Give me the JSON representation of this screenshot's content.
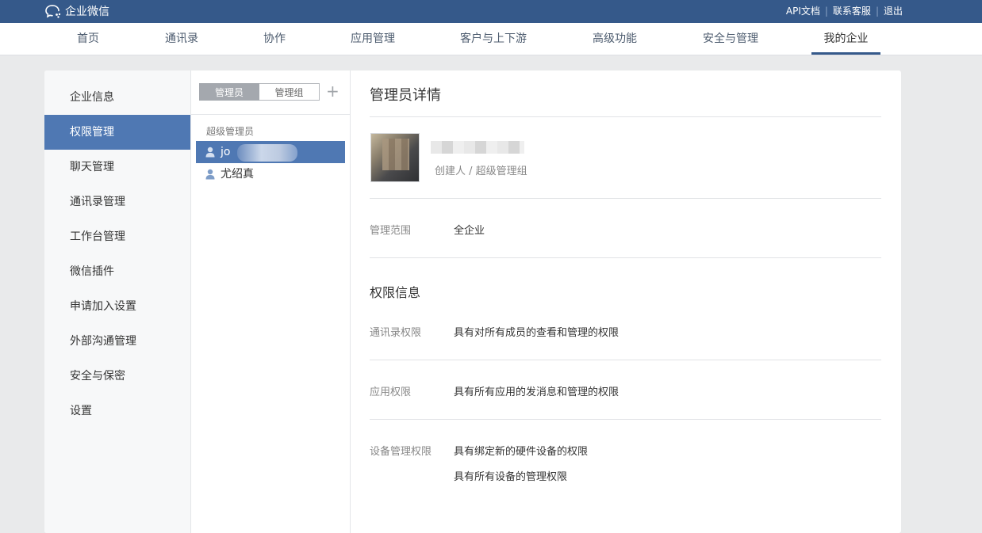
{
  "header": {
    "app_name": "企业微信",
    "links": [
      "API文档",
      "联系客服",
      "退出"
    ]
  },
  "nav": {
    "items": [
      "首页",
      "通讯录",
      "协作",
      "应用管理",
      "客户与上下游",
      "高级功能",
      "安全与管理",
      "我的企业"
    ],
    "active": "我的企业"
  },
  "sidebar": {
    "items": [
      "企业信息",
      "权限管理",
      "聊天管理",
      "通讯录管理",
      "工作台管理",
      "微信插件",
      "申请加入设置",
      "外部沟通管理",
      "安全与保密",
      "设置"
    ],
    "active": "权限管理"
  },
  "admin_list": {
    "tabs": [
      "管理员",
      "管理组"
    ],
    "active_tab": "管理员",
    "add_icon": "plus-icon",
    "group_label": "超级管理员",
    "members": [
      {
        "name": "jo",
        "active": true
      },
      {
        "name": "尤绍真",
        "active": false
      }
    ]
  },
  "detail": {
    "title": "管理员详情",
    "role": "创建人 / 超级管理组",
    "scope_label": "管理范围",
    "scope_value": "全企业",
    "permission_section_title": "权限信息",
    "permissions": [
      {
        "label": "通讯录权限",
        "values": [
          "具有对所有成员的查看和管理的权限"
        ]
      },
      {
        "label": "应用权限",
        "values": [
          "具有所有应用的发消息和管理的权限"
        ]
      },
      {
        "label": "设备管理权限",
        "values": [
          "具有绑定新的硬件设备的权限",
          "具有所有设备的管理权限"
        ]
      }
    ]
  },
  "colors": {
    "topbar": "#35598a",
    "accent": "#4f78b3",
    "page_bg": "#e9eaeb"
  }
}
